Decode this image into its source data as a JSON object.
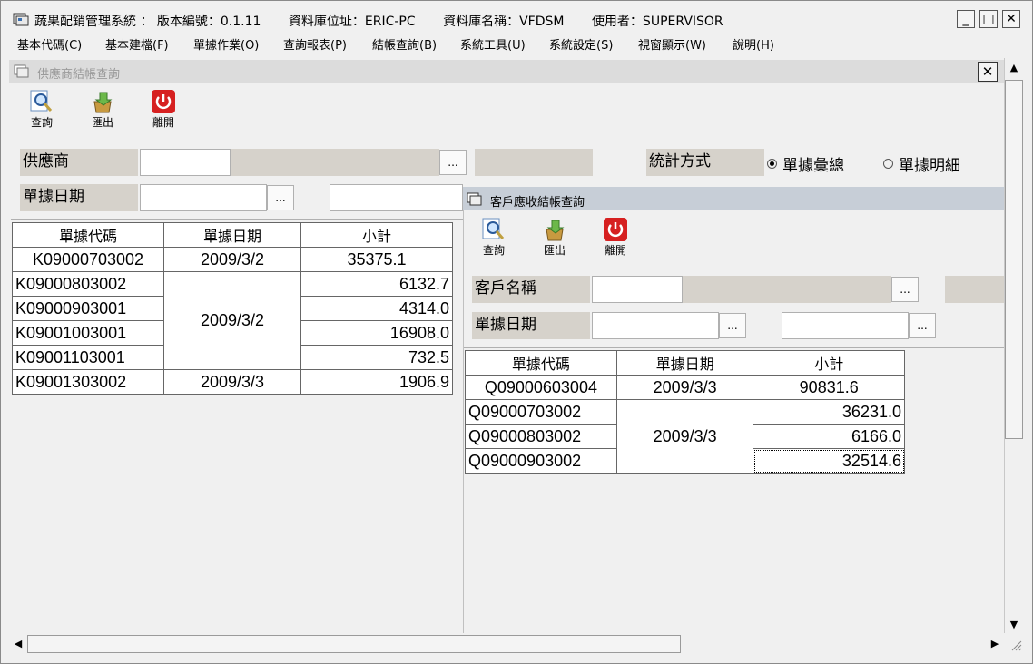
{
  "app": {
    "title": "蔬果配銷管理系統 ： 版本編號：0.1.11",
    "db_address": "資料庫位址：ERIC-PC",
    "db_name": "資料庫名稱：VFDSM",
    "user": "使用者：SUPERVISOR",
    "minimize": "_",
    "maximize": "□",
    "close": "✕"
  },
  "menu": [
    "基本代碼(C)",
    "基本建檔(F)",
    "單據作業(O)",
    "查詢報表(P)",
    "結帳查詢(B)",
    "系統工具(U)",
    "系統設定(S)",
    "視窗顯示(W)",
    "說明(H)"
  ],
  "supplier_window": {
    "title": "供應商結帳查詢",
    "close": "✕",
    "toolbar": {
      "query": "查詢",
      "export": "匯出",
      "exit": "離開"
    },
    "supplier_label": "供應商",
    "date_label": "單據日期",
    "browse": "...",
    "stat_label": "統計方式",
    "radio_summary": "單據彙總",
    "radio_detail": "單據明細",
    "grid": {
      "headers": [
        "單據代碼",
        "單據日期",
        "小計"
      ],
      "rows": [
        {
          "code": "K09000703002",
          "date": "2009/3/2",
          "subtotal": "35375.1"
        },
        {
          "code": "K09000803002",
          "date": "2009/3/2",
          "subtotal": "6132.7"
        },
        {
          "code": "K09000903001",
          "date": "",
          "subtotal": "4314.0"
        },
        {
          "code": "K09001003001",
          "date": "",
          "subtotal": "16908.0"
        },
        {
          "code": "K09001103001",
          "date": "",
          "subtotal": "732.5"
        },
        {
          "code": "K09001303002",
          "date": "2009/3/3",
          "subtotal": "1906.9"
        }
      ]
    }
  },
  "customer_window": {
    "title": "客戶應收結帳查詢",
    "toolbar": {
      "query": "查詢",
      "export": "匯出",
      "exit": "離開"
    },
    "customer_label": "客戶名稱",
    "date_label": "單據日期",
    "browse": "...",
    "grid": {
      "headers": [
        "單據代碼",
        "單據日期",
        "小計"
      ],
      "rows": [
        {
          "code": "Q09000603004",
          "date": "2009/3/3",
          "subtotal": "90831.6"
        },
        {
          "code": "Q09000703002",
          "date": "2009/3/3",
          "subtotal": "36231.0"
        },
        {
          "code": "Q09000803002",
          "date": "",
          "subtotal": "6166.0"
        },
        {
          "code": "Q09000903002",
          "date": "",
          "subtotal": "32514.6"
        }
      ]
    }
  },
  "colors": {
    "label_bg": "#d6d2cb",
    "active_title": "#c7ced7",
    "inactive_title": "#dcdcdc",
    "exit_red": "#d62020"
  }
}
